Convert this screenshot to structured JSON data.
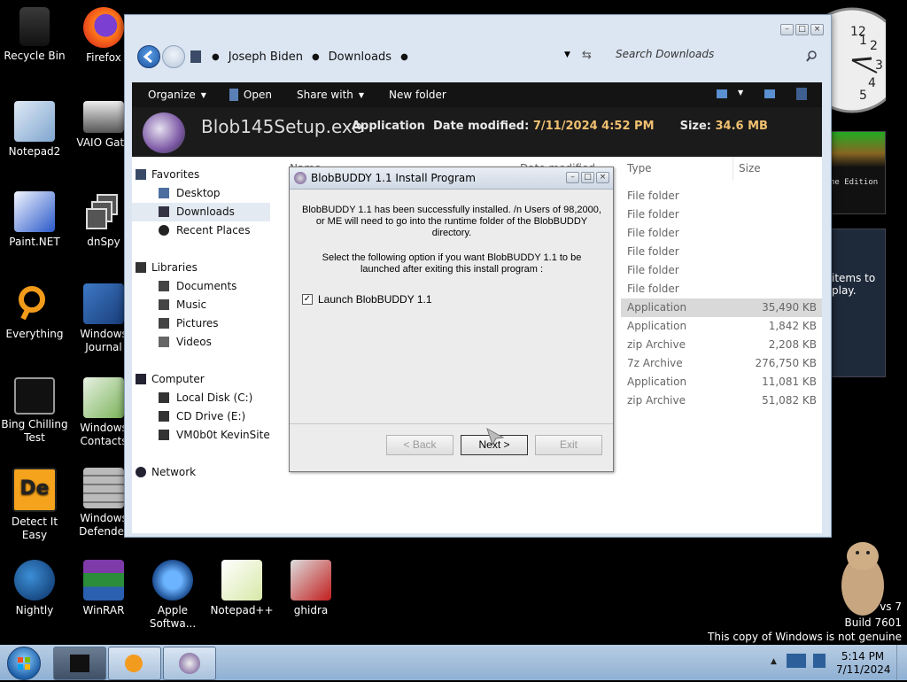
{
  "desktop": {
    "icons": [
      {
        "name": "Recycle Bin"
      },
      {
        "name": "Firefox"
      },
      {
        "name": "Notepad2"
      },
      {
        "name": "VAIO Gate"
      },
      {
        "name": "Paint.NET"
      },
      {
        "name": "dnSpy"
      },
      {
        "name": "Everything"
      },
      {
        "name": "Windows Journal"
      },
      {
        "name": "Bing Chilling Test"
      },
      {
        "name": "Windows Contacts"
      },
      {
        "name": "Detect It Easy"
      },
      {
        "name": "Windows Defender"
      },
      {
        "name": "Nightly"
      },
      {
        "name": "WinRAR"
      },
      {
        "name": "Apple Softwa..."
      },
      {
        "name": "Notepad++"
      },
      {
        "name": "ghidra"
      }
    ],
    "gadget_text": "ne Edition",
    "gadget_text2": "items to play.",
    "watermark": {
      "line1": "vs 7",
      "line2": "Build 7601",
      "line3": "This copy of Windows is not genuine"
    },
    "clock_numbers": [
      "12",
      "1",
      "2",
      "3",
      "4",
      "5"
    ]
  },
  "explorer": {
    "address": {
      "crumbs": [
        "Joseph Biden",
        "Downloads"
      ]
    },
    "search_placeholder": "Search Downloads",
    "toolbar": {
      "organize": "Organize",
      "open": "Open",
      "share_with": "Share with",
      "new_folder": "New folder"
    },
    "details": {
      "filename": "Blob145Setup.exe",
      "type": "Application",
      "date_label": "Date modified:",
      "date_value": "7/11/2024 4:52 PM",
      "size_label": "Size:",
      "size_value": "34.6 MB"
    },
    "nav": {
      "favorites": "Favorites",
      "desktop": "Desktop",
      "downloads": "Downloads",
      "recent_places": "Recent Places",
      "libraries": "Libraries",
      "documents": "Documents",
      "music": "Music",
      "pictures": "Pictures",
      "videos": "Videos",
      "computer": "Computer",
      "local_disk": "Local Disk (C:)",
      "cd_drive": "CD Drive (E:)",
      "vm_site": "VM0b0t KevinSite",
      "network": "Network"
    },
    "columns": {
      "name": "Name",
      "date_modified": "Date modified",
      "type": "Type",
      "size": "Size"
    },
    "files": [
      {
        "type": "File folder",
        "size": ""
      },
      {
        "type": "File folder",
        "size": ""
      },
      {
        "type": "File folder",
        "size": ""
      },
      {
        "type": "File folder",
        "size": ""
      },
      {
        "type": "File folder",
        "size": ""
      },
      {
        "type": "File folder",
        "size": ""
      },
      {
        "type": "Application",
        "size": "35,490 KB"
      },
      {
        "type": "Application",
        "size": "1,842 KB"
      },
      {
        "type": "zip Archive",
        "size": "2,208 KB"
      },
      {
        "type": "7z Archive",
        "size": "276,750 KB"
      },
      {
        "type": "Application",
        "size": "11,081 KB"
      },
      {
        "type": "zip Archive",
        "size": "51,082 KB"
      }
    ]
  },
  "dialog": {
    "title": "BlobBUDDY 1.1 Install Program",
    "message1": "BlobBUDDY 1.1 has been successfully installed. /n Users of 98,2000, or ME will need to go into the runtime folder of the BlobBUDDY directory.",
    "message2": "Select the following option if you want BlobBUDDY 1.1 to be launched after exiting this install program :",
    "checkbox_label": "Launch BlobBUDDY 1.1",
    "checkbox_checked": true,
    "buttons": {
      "back": "< Back",
      "next": "Next >",
      "exit": "Exit"
    }
  },
  "taskbar": {
    "time": "5:14 PM",
    "date": "7/11/2024"
  }
}
